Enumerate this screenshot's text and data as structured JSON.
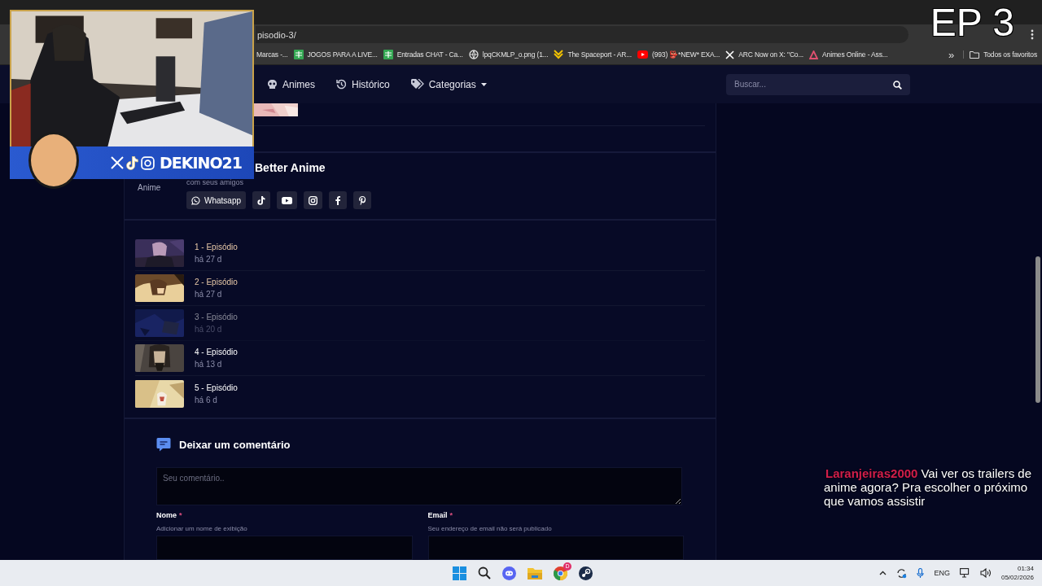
{
  "browser": {
    "address": "pisodio-3/",
    "bookmarks": [
      {
        "label": "Marcas -..."
      },
      {
        "label": "JOGOS PARA A LIVE...",
        "kind": "sheet"
      },
      {
        "label": "Entradas CHAT - Ca...",
        "kind": "sheet"
      },
      {
        "label": "lpqCKMLP_o.png (1...",
        "kind": "globe"
      },
      {
        "label": "The Spaceport - AR...",
        "kind": "chevron"
      },
      {
        "label": "(993) 👺*NEW* EXA...",
        "kind": "video"
      },
      {
        "label": "ARC Now on X: \"Co...",
        "kind": "x"
      },
      {
        "label": "Animes Online - Ass...",
        "kind": "triangle"
      }
    ],
    "more": "»",
    "all_bookmarks": "Todos os favoritos"
  },
  "nav": {
    "items": [
      {
        "label": "Animes",
        "kind": "skull"
      },
      {
        "label": "Histórico",
        "kind": "history"
      },
      {
        "label": "Categorias",
        "kind": "tags",
        "dropdown": true
      }
    ],
    "search": {
      "placeholder": "Buscar..."
    }
  },
  "share": {
    "title": "Better Anime",
    "subtitle": "com seus amigos",
    "side_label": "Anime",
    "whatsapp": "Whatsapp"
  },
  "episodes": [
    {
      "title": "1 - Episódio",
      "age": "há 27 d",
      "kind": "watched"
    },
    {
      "title": "2 - Episódio",
      "age": "há 27 d",
      "kind": "watched"
    },
    {
      "title": "3 - Episódio",
      "age": "há 20 d",
      "kind": "current"
    },
    {
      "title": "4 - Episódio",
      "age": "há 13 d",
      "kind": "new"
    },
    {
      "title": "5 - Episódio",
      "age": "há 6 d",
      "kind": "new"
    }
  ],
  "comment": {
    "title": "Deixar um comentário",
    "placeholder": "Seu comentário..",
    "fields": [
      {
        "label": "Nome",
        "required_mark": "*",
        "hint": "Adicionar um nome de exibição"
      },
      {
        "label": "Email",
        "required_mark": "*",
        "hint": "Seu endereço de email não será publicado"
      }
    ]
  },
  "overlay": {
    "handle": "DEKINO21",
    "episode_badge": "EP 3",
    "chat": {
      "user": "Laranjeiras2000",
      "message": "Vai ver os trailers de anime agora? Pra escolher o próximo que vamos assistir"
    }
  },
  "taskbar": {
    "chrome_badge": "D",
    "language": "ENG",
    "time": "01:34",
    "date": "05/02/2026"
  }
}
